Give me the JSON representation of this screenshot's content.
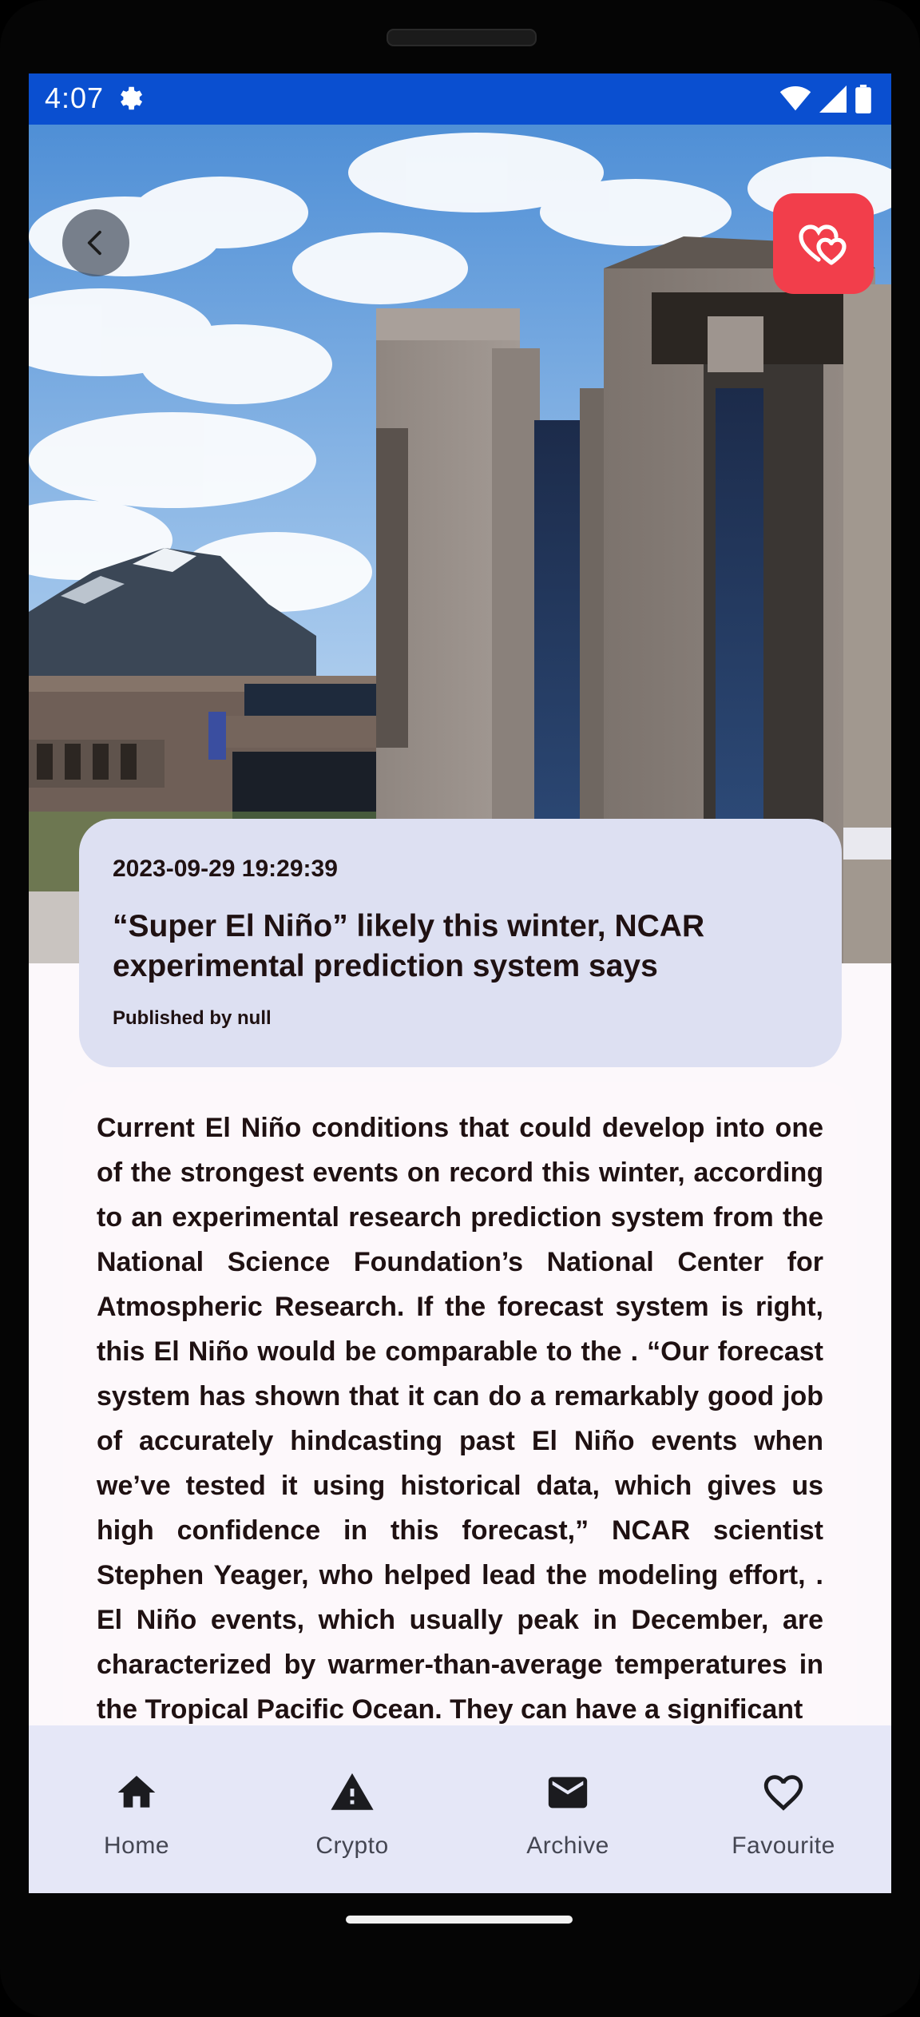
{
  "status_bar": {
    "time": "4:07",
    "icons": [
      "settings-gear-icon",
      "wifi-icon",
      "cellular-signal-icon",
      "battery-icon"
    ]
  },
  "hero": {
    "image_description": "ncar-mesa-lab-building-photo",
    "back_icon": "chevron-left-icon",
    "favourite_icon": "double-heart-icon",
    "favourite_color": "#f23e4b"
  },
  "article": {
    "date": "2023-09-29 19:29:39",
    "title": "“Super El Niño” likely this winter, NCAR experimental prediction system says",
    "author": "Published by null",
    "body": "Current El Niño conditions that could develop into one of the strongest events on record this winter, according to an experimental research prediction system from the National Science Foundation’s National Center for Atmospheric Research. If the forecast system is right, this El Niño would be comparable to the . “Our forecast system has shown that it can do a remarkably good job of accurately hindcasting past El Niño events when we’ve tested it using historical data, which gives us high confidence in this forecast,” NCAR scientist Stephen Yeager, who helped lead the modeling effort, . El Niño events, which usually peak in December, are characterized by warmer-than-average temperatures in the Tropical Pacific Ocean. They can have a significant"
  },
  "bottom_nav": {
    "items": [
      {
        "label": "Home",
        "icon": "home-icon"
      },
      {
        "label": "Crypto",
        "icon": "warning-icon"
      },
      {
        "label": "Archive",
        "icon": "mail-icon"
      },
      {
        "label": "Favourite",
        "icon": "heart-outline-icon"
      }
    ]
  },
  "colors": {
    "status_bar": "#0a4fd0",
    "card_bg": "#dde0f2",
    "nav_bg": "#e5e7f7",
    "text": "#1f1112"
  }
}
